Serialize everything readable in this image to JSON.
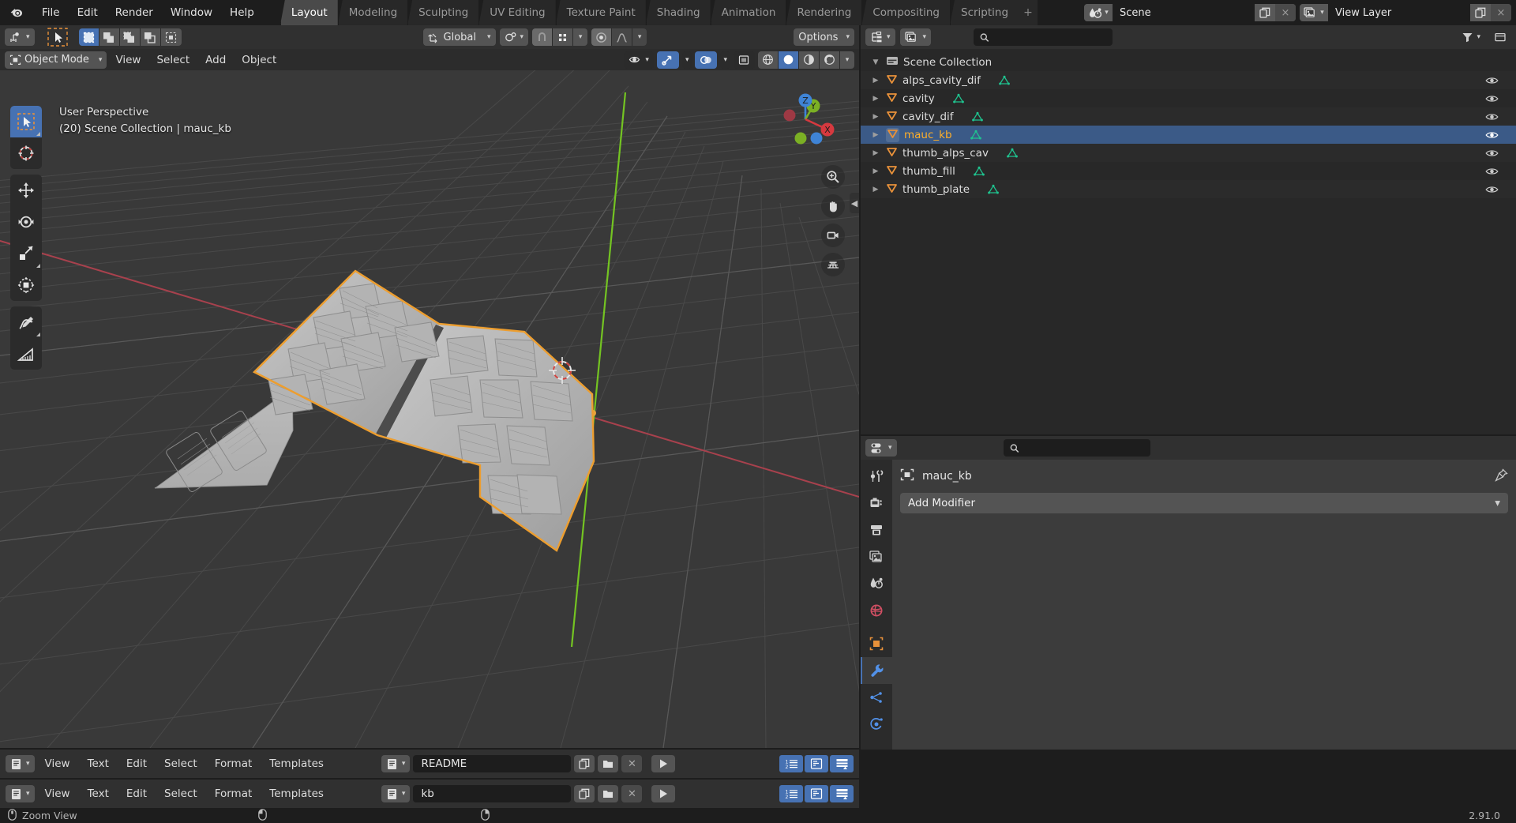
{
  "app": {
    "name": "Blender",
    "version": "2.91.0"
  },
  "topbar": {
    "menus": [
      "File",
      "Edit",
      "Render",
      "Window",
      "Help"
    ],
    "workspaces": [
      "Layout",
      "Modeling",
      "Sculpting",
      "UV Editing",
      "Texture Paint",
      "Shading",
      "Animation",
      "Rendering",
      "Compositing",
      "Scripting"
    ],
    "active_workspace": "Layout",
    "add_workspace_label": "+",
    "scene": {
      "name": "Scene",
      "icon": "scene-icon",
      "new_label": "",
      "delete_label": "×"
    },
    "view_layer": {
      "name": "View Layer",
      "icon": "view-layer-icon",
      "new_label": "",
      "delete_label": "×"
    }
  },
  "viewport": {
    "mode": "Object Mode",
    "menus": [
      "View",
      "Select",
      "Add",
      "Object"
    ],
    "transform_orientation": "Global",
    "options_label": "Options",
    "overlay_line1": "User Perspective",
    "overlay_line2": "(20) Scene Collection | mauc_kb",
    "gizmo_axes": [
      "X",
      "Y",
      "Z"
    ],
    "tools": [
      "tweak-select-tool",
      "cursor-tool",
      "move-tool",
      "rotate-tool",
      "scale-tool",
      "transform-tool",
      "annotate-tool",
      "measure-tool"
    ],
    "active_tool": "tweak-select-tool",
    "nav_buttons": [
      "zoom-icon",
      "hand-icon",
      "camera-icon",
      "grid-icon"
    ],
    "shading_modes": [
      "wireframe",
      "solid",
      "material-preview",
      "rendered"
    ],
    "active_shading": "solid"
  },
  "outliner": {
    "display_mode": "View Layer",
    "search_placeholder": "",
    "root": "Scene Collection",
    "items": [
      {
        "label": "alps_cavity_dif",
        "selected": false,
        "has_mesh_icon": true
      },
      {
        "label": "cavity",
        "selected": false,
        "has_mesh_icon": true
      },
      {
        "label": "cavity_dif",
        "selected": false,
        "has_mesh_icon": true
      },
      {
        "label": "mauc_kb",
        "selected": true,
        "has_mesh_icon": true
      },
      {
        "label": "thumb_alps_cav",
        "selected": false,
        "has_mesh_icon": true
      },
      {
        "label": "thumb_fill",
        "selected": false,
        "has_mesh_icon": true
      },
      {
        "label": "thumb_plate",
        "selected": false,
        "has_mesh_icon": true
      }
    ]
  },
  "properties": {
    "search_placeholder": "",
    "object_name": "mauc_kb",
    "add_modifier_label": "Add Modifier",
    "tabs": [
      "tool-tab",
      "render-tab",
      "output-tab",
      "view-layer-tab",
      "scene-tab",
      "world-tab",
      "object-tab",
      "modifier-tab",
      "particles-tab",
      "physics-tab"
    ],
    "active_tab": "modifier-tab"
  },
  "text_editors": [
    {
      "menus": [
        "View",
        "Text",
        "Edit",
        "Select",
        "Format",
        "Templates"
      ],
      "file_name": "README",
      "buttons": [
        "new-text-icon",
        "open-text-icon",
        "unlink-text-icon",
        "run-script-icon"
      ],
      "toggles": [
        "line-numbers-icon",
        "word-wrap-icon",
        "syntax-highlight-icon"
      ]
    },
    {
      "menus": [
        "View",
        "Text",
        "Edit",
        "Select",
        "Format",
        "Templates"
      ],
      "file_name": "kb",
      "buttons": [
        "new-text-icon",
        "open-text-icon",
        "unlink-text-icon",
        "run-script-icon"
      ],
      "toggles": [
        "line-numbers-icon",
        "word-wrap-icon",
        "syntax-highlight-icon"
      ]
    }
  ],
  "statusbar": {
    "mouse_hint_1": "Zoom View",
    "mouse_hint_2": "",
    "mouse_hint_3": "",
    "version": "2.91.0"
  },
  "colors": {
    "accent_blue": "#4772b3",
    "selection_orange": "#ffaf29",
    "mesh_green": "#1fc38f",
    "object_orange": "#e8913a",
    "bg_dark": "#1d1d1d",
    "bg_panel": "#303030",
    "viewport_bg": "#393939"
  }
}
